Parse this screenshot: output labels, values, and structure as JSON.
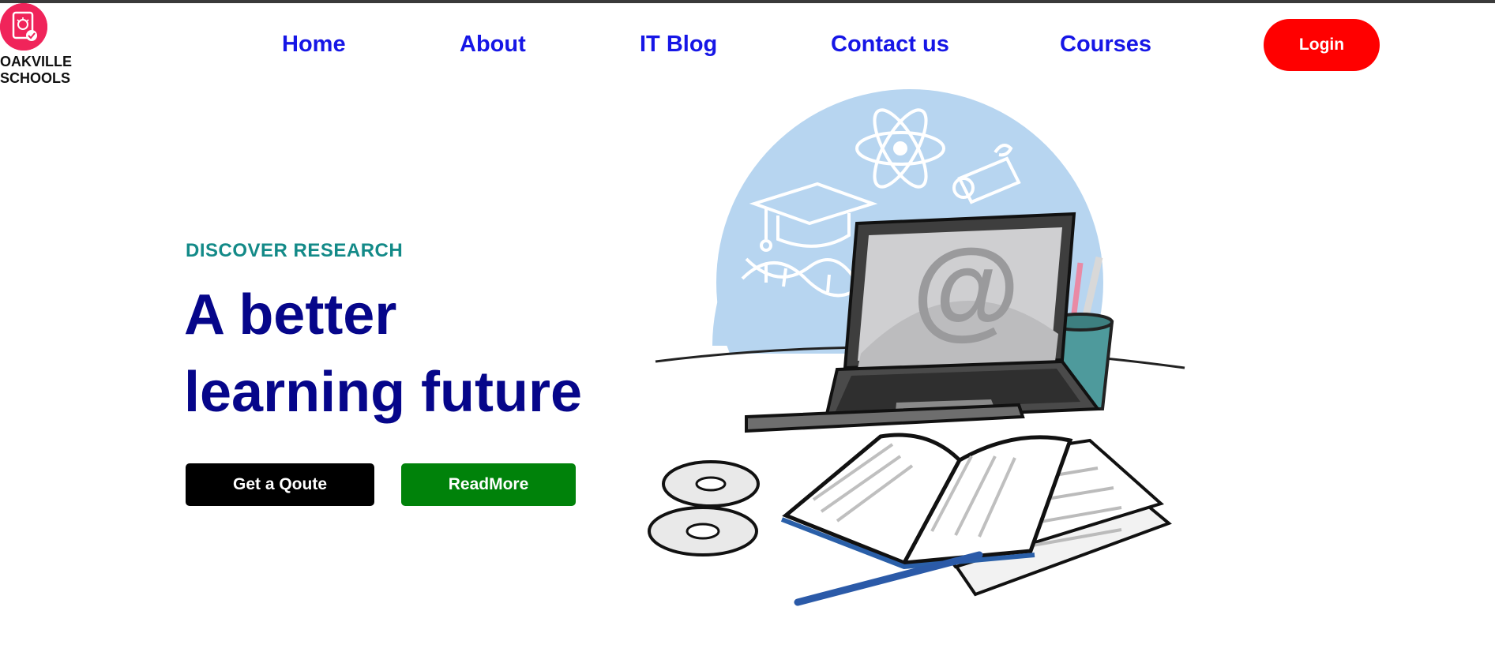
{
  "brand": {
    "name_line1": "OAKVILLE",
    "name_line2": "SCHOOLS",
    "logo_icon": "school-badge-icon",
    "accent_color": "#f0245a"
  },
  "nav": {
    "items": [
      {
        "label": "Home"
      },
      {
        "label": "About"
      },
      {
        "label": "IT Blog"
      },
      {
        "label": "Contact us"
      },
      {
        "label": "Courses"
      }
    ],
    "link_color": "#1616e6",
    "login_label": "Login",
    "login_color": "#ff0000"
  },
  "hero": {
    "eyebrow": "DISCOVER RESEARCH",
    "headline": "A better learning future",
    "quote_button": "Get a Qoute",
    "readmore_button": "ReadMore",
    "headline_color": "#06068a",
    "eyebrow_color": "#138a88"
  },
  "illustration": {
    "subject": "laptop-books-education-illustration",
    "laptop_screen_symbol": "@"
  }
}
